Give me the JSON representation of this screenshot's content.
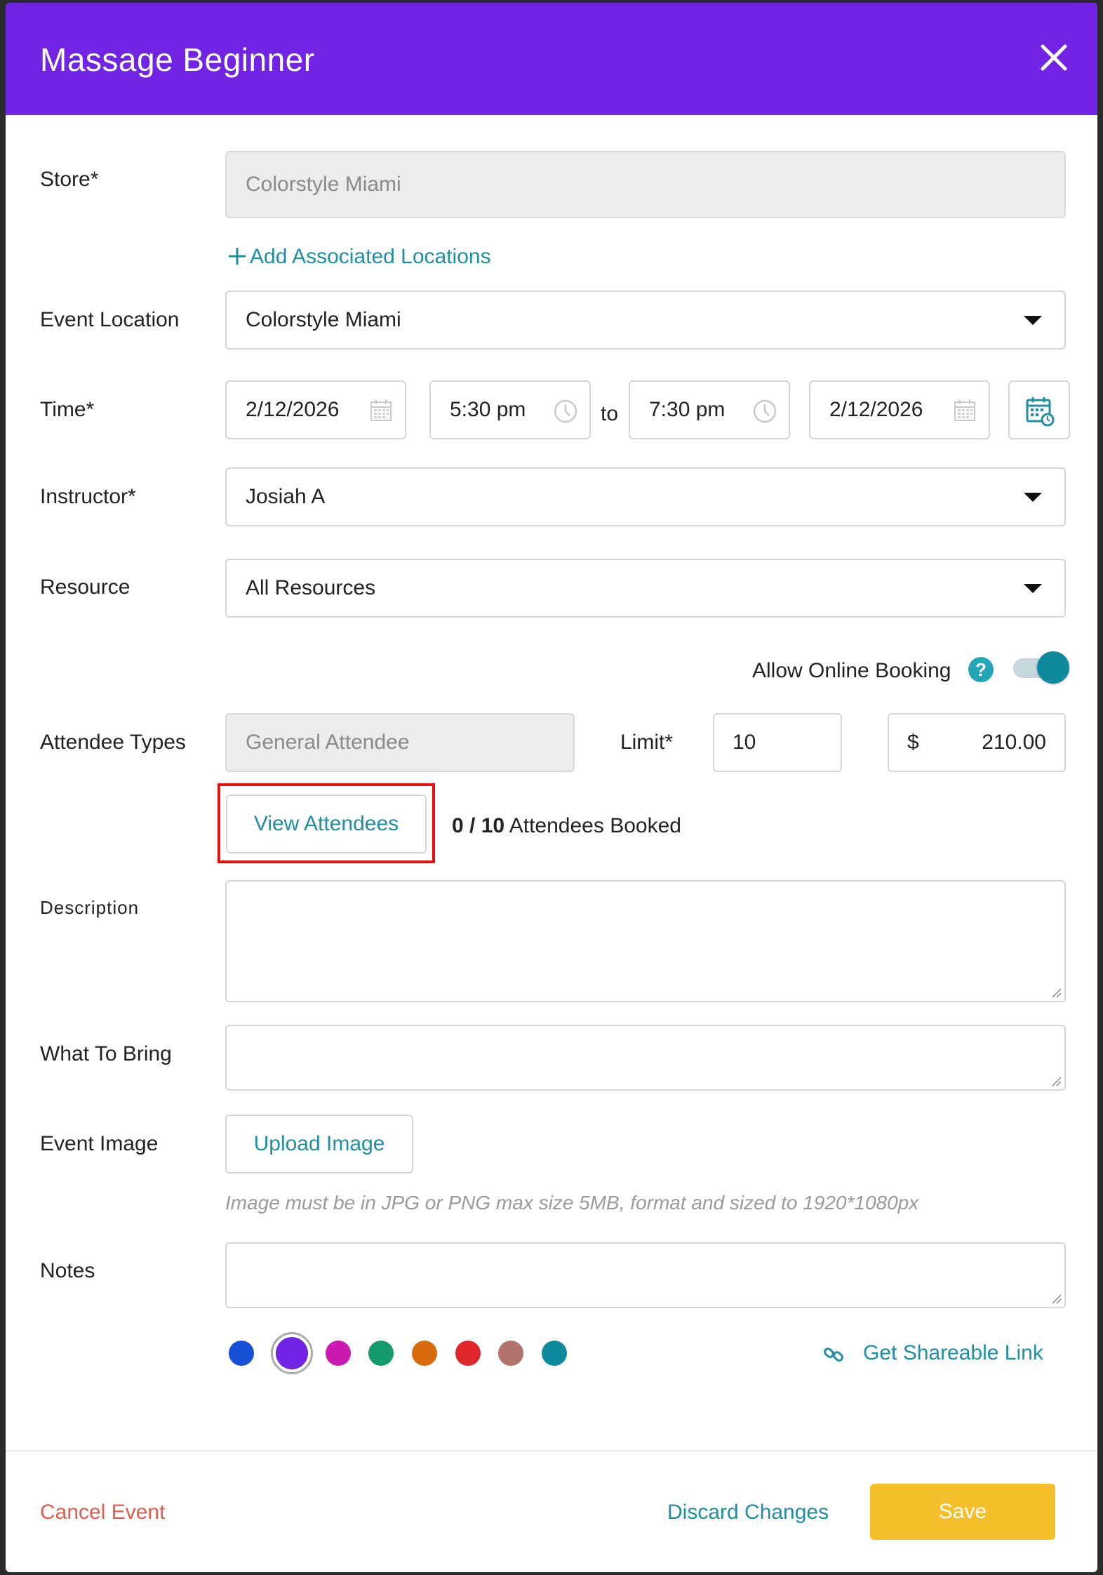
{
  "modal": {
    "title": "Massage Beginner"
  },
  "form": {
    "store": {
      "label": "Store*",
      "value": "Colorstyle Miami"
    },
    "add_locations": "Add Associated Locations",
    "event_location": {
      "label": "Event Location",
      "value": "Colorstyle Miami"
    },
    "time": {
      "label": "Time*",
      "start_date": "2/12/2026",
      "start_time": "5:30 pm",
      "separator": "to",
      "end_time": "7:30 pm",
      "end_date": "2/12/2026"
    },
    "instructor": {
      "label": "Instructor*",
      "value": "Josiah A"
    },
    "resource": {
      "label": "Resource",
      "value": "All Resources"
    },
    "online_booking": {
      "label": "Allow Online Booking",
      "help": "?",
      "enabled": true
    },
    "attendee_types": {
      "label": "Attendee Types",
      "value": "General Attendee",
      "limit_label": "Limit*",
      "limit_value": "10",
      "currency": "$",
      "price": "210.00"
    },
    "attendees": {
      "view_button": "View Attendees",
      "booked_count": "0 / 10",
      "booked_suffix": "Attendees Booked"
    },
    "description": {
      "label": "Description"
    },
    "what_to_bring": {
      "label": "What To Bring"
    },
    "event_image": {
      "label": "Event Image",
      "upload_button": "Upload Image",
      "hint": "Image must be in JPG or PNG max size 5MB, format and sized to 1920*1080px"
    },
    "notes": {
      "label": "Notes"
    },
    "colors": [
      "#1750d6",
      "#7124e3",
      "#cc1ab0",
      "#149a6c",
      "#d96b0f",
      "#e0262d",
      "#b0726a",
      "#0e8a9c"
    ],
    "selected_color": "#7124e3",
    "share_link": "Get Shareable Link"
  },
  "footer": {
    "cancel": "Cancel Event",
    "discard": "Discard Changes",
    "save": "Save"
  },
  "theme": {
    "header": "#7124e3",
    "accent": "#1f8fa3",
    "danger": "#e25c4d",
    "save": "#f5bf2b",
    "highlight": "#e81010"
  }
}
